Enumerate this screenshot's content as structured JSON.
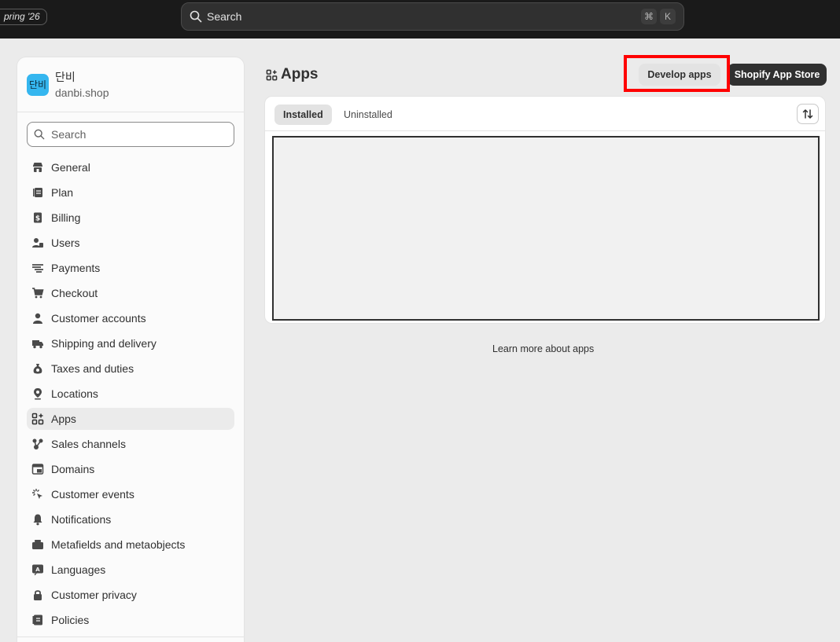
{
  "topbar": {
    "edition_badge": "pring '26",
    "search_placeholder": "Search",
    "shortcut_keys": [
      "⌘",
      "K"
    ]
  },
  "store": {
    "avatar_text": "단비",
    "name": "단비",
    "domain": "danbi.shop"
  },
  "settings_search": {
    "placeholder": "Search"
  },
  "nav": {
    "items": [
      {
        "label": "General",
        "icon": "store-icon"
      },
      {
        "label": "Plan",
        "icon": "plan-icon"
      },
      {
        "label": "Billing",
        "icon": "billing-icon"
      },
      {
        "label": "Users",
        "icon": "users-icon"
      },
      {
        "label": "Payments",
        "icon": "payments-icon"
      },
      {
        "label": "Checkout",
        "icon": "cart-icon"
      },
      {
        "label": "Customer accounts",
        "icon": "person-icon"
      },
      {
        "label": "Shipping and delivery",
        "icon": "truck-icon"
      },
      {
        "label": "Taxes and duties",
        "icon": "money-bag-icon"
      },
      {
        "label": "Locations",
        "icon": "location-pin-icon"
      },
      {
        "label": "Apps",
        "icon": "apps-icon"
      },
      {
        "label": "Sales channels",
        "icon": "sales-channels-icon"
      },
      {
        "label": "Domains",
        "icon": "domains-icon"
      },
      {
        "label": "Customer events",
        "icon": "cursor-click-icon"
      },
      {
        "label": "Notifications",
        "icon": "bell-icon"
      },
      {
        "label": "Metafields and metaobjects",
        "icon": "metafields-icon"
      },
      {
        "label": "Languages",
        "icon": "language-icon"
      },
      {
        "label": "Customer privacy",
        "icon": "lock-icon"
      },
      {
        "label": "Policies",
        "icon": "policies-icon"
      }
    ],
    "active": "Apps"
  },
  "main": {
    "title": "Apps",
    "develop_button": "Develop apps",
    "store_button": "Shopify App Store",
    "tabs": {
      "installed": "Installed",
      "uninstalled": "Uninstalled"
    },
    "learn_more": "Learn more about apps"
  },
  "colors": {
    "topbar_bg": "#1a1a1a",
    "page_bg": "#ebebeb",
    "highlight": "#ff0000",
    "avatar_bg": "#35b6ef",
    "primary_button_bg": "#303030"
  }
}
